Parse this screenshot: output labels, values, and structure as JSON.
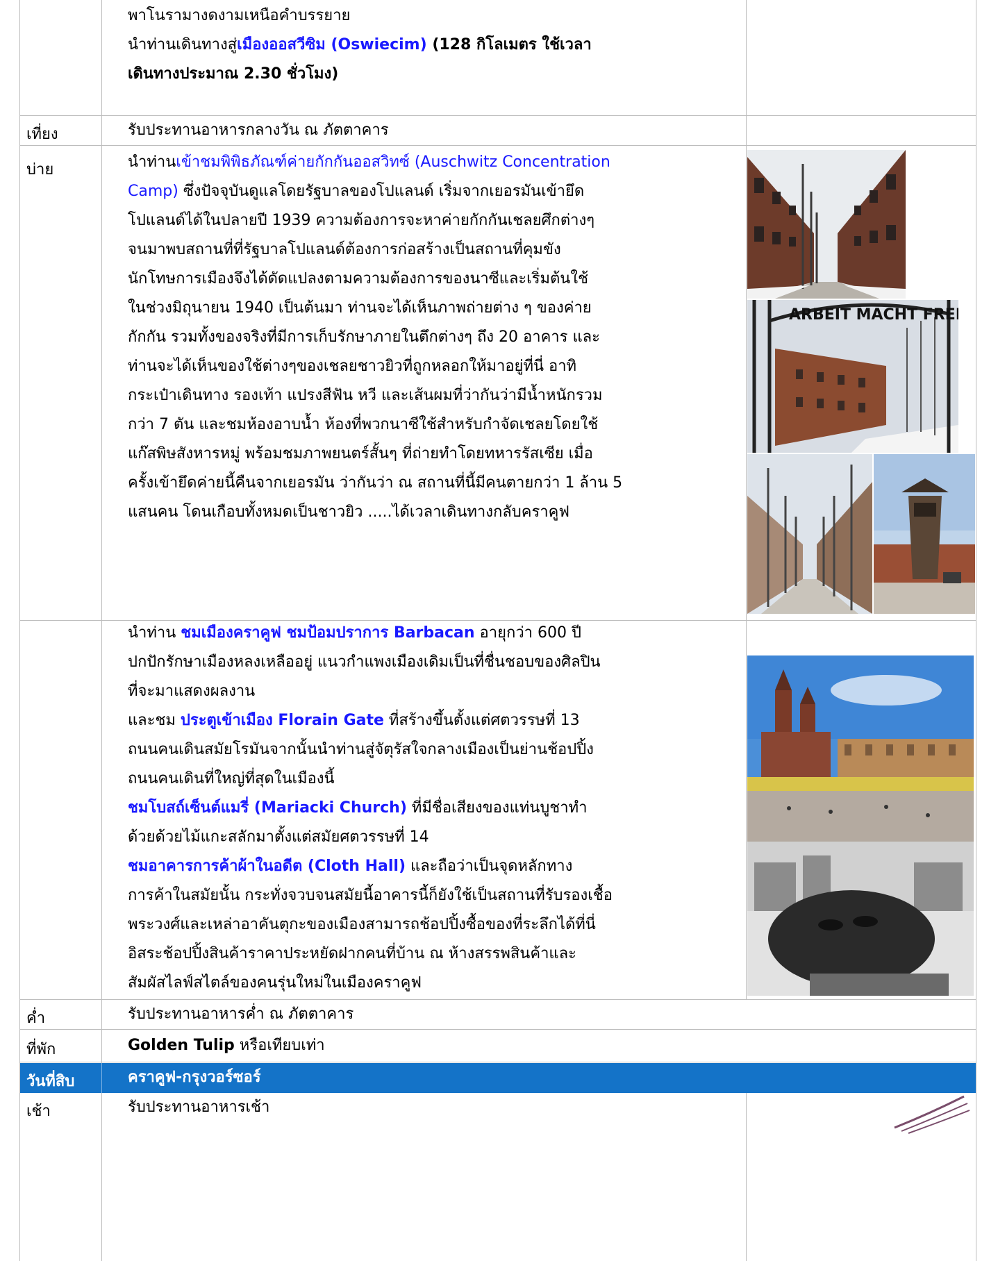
{
  "rows": [
    {
      "time": "",
      "lines": [
        "พาโนรามางดงามเหนือคำบรรยาย",
        "นำท่านเดินทางสู่",
        "เมืองออสวีซิม (Oswiecim)",
        " (128 กิโลเมตร ใช้เวลา",
        "เดินทางประมาณ 2.30 ชั่วโมง)"
      ]
    },
    {
      "time": "เที่ยง",
      "text": "รับประทานอาหารกลางวัน ณ ภัตตาคาร"
    },
    {
      "time": "บ่าย",
      "intro": "นำท่าน",
      "link1": "เข้าชมพิพิธภัณฑ์ค่ายกักกันออสวิทซ์ (Auschwitz Concentration",
      "link2": "Camp)",
      "rest": [
        "  ซึ่งปัจจุบันดูแลโดยรัฐบาลของโปแลนด์ เริ่มจากเยอรมันเข้ายึด",
        "โปแลนด์ได้ในปลายปี 1939 ความต้องการจะหาค่ายกักกันเชลยศึกต่างๆ",
        "จนมาพบสถานที่ที่รัฐบาลโปแลนด์ต้องการก่อสร้างเป็นสถานที่คุมขัง",
        "นักโทษการเมืองจึงได้ดัดแปลงตามความต้องการของนาซีและเริ่มต้นใช้",
        "ในช่วงมิถุนายน 1940 เป็นต้นมา ท่านจะได้เห็นภาพถ่ายต่าง ๆ ของค่าย",
        "กักกัน รวมทั้งของจริงที่มีการเก็บรักษาภายในตึกต่างๆ ถึง 20 อาคาร และ",
        "ท่านจะได้เห็นของใช้ต่างๆของเชลยชาวยิวที่ถูกหลอกให้มาอยู่ที่นี่ อาทิ",
        "กระเป๋าเดินทาง รองเท้า แปรงสีฟัน หวี และเส้นผมที่ว่ากันว่ามีน้ำหนักรวม",
        "กว่า 7 ตัน และชมห้องอาบน้ำ ห้องที่พวกนาซีใช้สำหรับกำจัดเชลยโดยใช้",
        "แก๊สพิษสังหารหมู่ พร้อมชมภาพยนตร์สั้นๆ ที่ถ่ายทำโดยทหารรัสเซีย เมื่อ",
        "ครั้งเข้ายึดค่ายนี้คืนจากเยอรมัน ว่ากันว่า ณ สถานที่นี้มีคนตายกว่า 1 ล้าน 5",
        "แสนคน โดนเกือบทั้งหมดเป็นชาวยิว .....ได้เวลาเดินทางกลับคราคูฟ"
      ],
      "gate_sign": "ARBEIT MACHT FREI"
    },
    {
      "time": "",
      "p1a": " นำท่าน ",
      "p1b": "ชมเมืองคราคูฟ ชมป้อมปราการ Barbacan",
      "p1c": " อายุกว่า 600 ปี",
      "p1d": "ปกปักรักษาเมืองหลงเหลืออยู่ แนวกำแพงเมืองเดิมเป็นที่ชื่นชอบของศิลปิน",
      "p1e": "ที่จะมาแสดงผลงาน",
      "p2a": " และชม ",
      "p2b": "ประตูเข้าเมือง Florain Gate",
      "p2c": " ที่สร้างขึ้นตั้งแต่ศตวรรษที่ 13",
      "p2d": "ถนนคนเดินสมัยโรมันจากนั้นนำท่านสู่จัตุรัสใจกลางเมืองเป็นย่านช้อปปิ้ง",
      "p2e": "ถนนคนเดินที่ใหญ่ที่สุดในเมืองนี้",
      "p3a": " ชมโบสถ์เซ็นต์แมรี่  (Mariacki Church)",
      "p3b": "  ที่มีชื่อเสียงของแท่นบูชาทำ",
      "p3c": "ด้วยด้วยไม้แกะสลักมาตั้งแต่สมัยศตวรรษที่ 14",
      "p4a": " ชมอาคารการค้าผ้าในอดีต (Cloth Hall)",
      "p4b": " และถือว่าเป็นจุดหลักทาง",
      "p4c": "การค้าในสมัยนั้น กระทั่งจวบจนสมัยนี้อาคารนี้ก็ยังใช้เป็นสถานที่รับรองเชื้อ",
      "p4d": "พระวงศ์และเหล่าอาคันตุกะของเมืองสามารถช้อปปิ้งซื้อของที่ระลึกได้ที่นี่",
      "p4e": " อิสระช้อปปิ้งสินค้าราคาประหยัดฝากคนที่บ้าน ณ ห้างสรรพสินค้าและ",
      "p4f": " สัมผัสไลฟ์สไตล์ของคนรุ่นใหม่ในเมืองคราคูฟ"
    },
    {
      "time": "ค่ำ",
      "text": "รับประทานอาหารค่ำ ณ ภัตตาคาร"
    },
    {
      "time": "ที่พัก",
      "hotel": "Golden Tulip",
      "hotel_rest": " หรือเทียบเท่า"
    },
    {
      "time": "วันที่สิบ",
      "text": "คราคูฟ-กรุงวอร์ซอร์"
    },
    {
      "time": "เช้า",
      "text": "รับประทานอาหารเช้า"
    }
  ],
  "colors": {
    "link": "#1a1aff",
    "header_bg": "#1473c8",
    "border": "#bdbdbd"
  }
}
